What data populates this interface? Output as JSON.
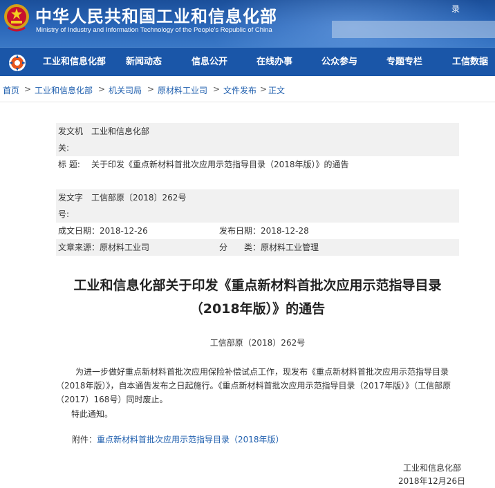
{
  "header": {
    "title": "中华人民共和国工业和信息化部",
    "subtitle": "Ministry of Industry and Information Technology of the People's Republic of China",
    "login_label": "录"
  },
  "nav": {
    "items": [
      "工业和信息化部",
      "新闻动态",
      "信息公开",
      "在线办事",
      "公众参与",
      "专题专栏",
      "工信数据"
    ]
  },
  "breadcrumb": {
    "items": [
      "首页",
      "工业和信息化部",
      "机关司局",
      "原材料工业司",
      "文件发布",
      "正文"
    ],
    "separator": ">"
  },
  "meta": {
    "issuer_label": "发文机关:",
    "issuer_value": "工业和信息化部",
    "title_label": "标 题:",
    "title_value": "关于印发《重点新材料首批次应用示范指导目录（2018年版）》的通告",
    "docno_label": "发文字号:",
    "docno_value": "工信部原〔2018〕262号",
    "created_label": "成文日期：",
    "created_value": "2018-12-26",
    "published_label": "发布日期：",
    "published_value": "2018-12-28",
    "source_label": "文章来源：",
    "source_value": "原材料工业司",
    "category_label": "分　　类：",
    "category_value": "原材料工业管理"
  },
  "article": {
    "title_line1": "工业和信息化部关于印发《重点新材料首批次应用示范指导目录",
    "title_line2": "（2018年版）》的通告",
    "doc_number": "工信部原（2018）262号",
    "body": "为进一步做好重点新材料首批次应用保险补偿试点工作，现发布《重点新材料首批次应用示范指导目录（2018年版）》，自本通告发布之日起施行。《重点新材料首批次应用示范指导目录（2017年版）》（工信部原（2017）168号）同时废止。",
    "notice": "特此通知。",
    "attachment_label": "附件：",
    "attachment_link": "重点新材料首批次应用示范指导目录（2018年版）",
    "sign_org": "工业和信息化部",
    "sign_date": "2018年12月26日"
  },
  "colors": {
    "header_blue": "#1b4f9a",
    "nav_blue": "#1a56a8",
    "link_blue": "#1f5fae",
    "meta_shade": "#f1f1f1"
  }
}
